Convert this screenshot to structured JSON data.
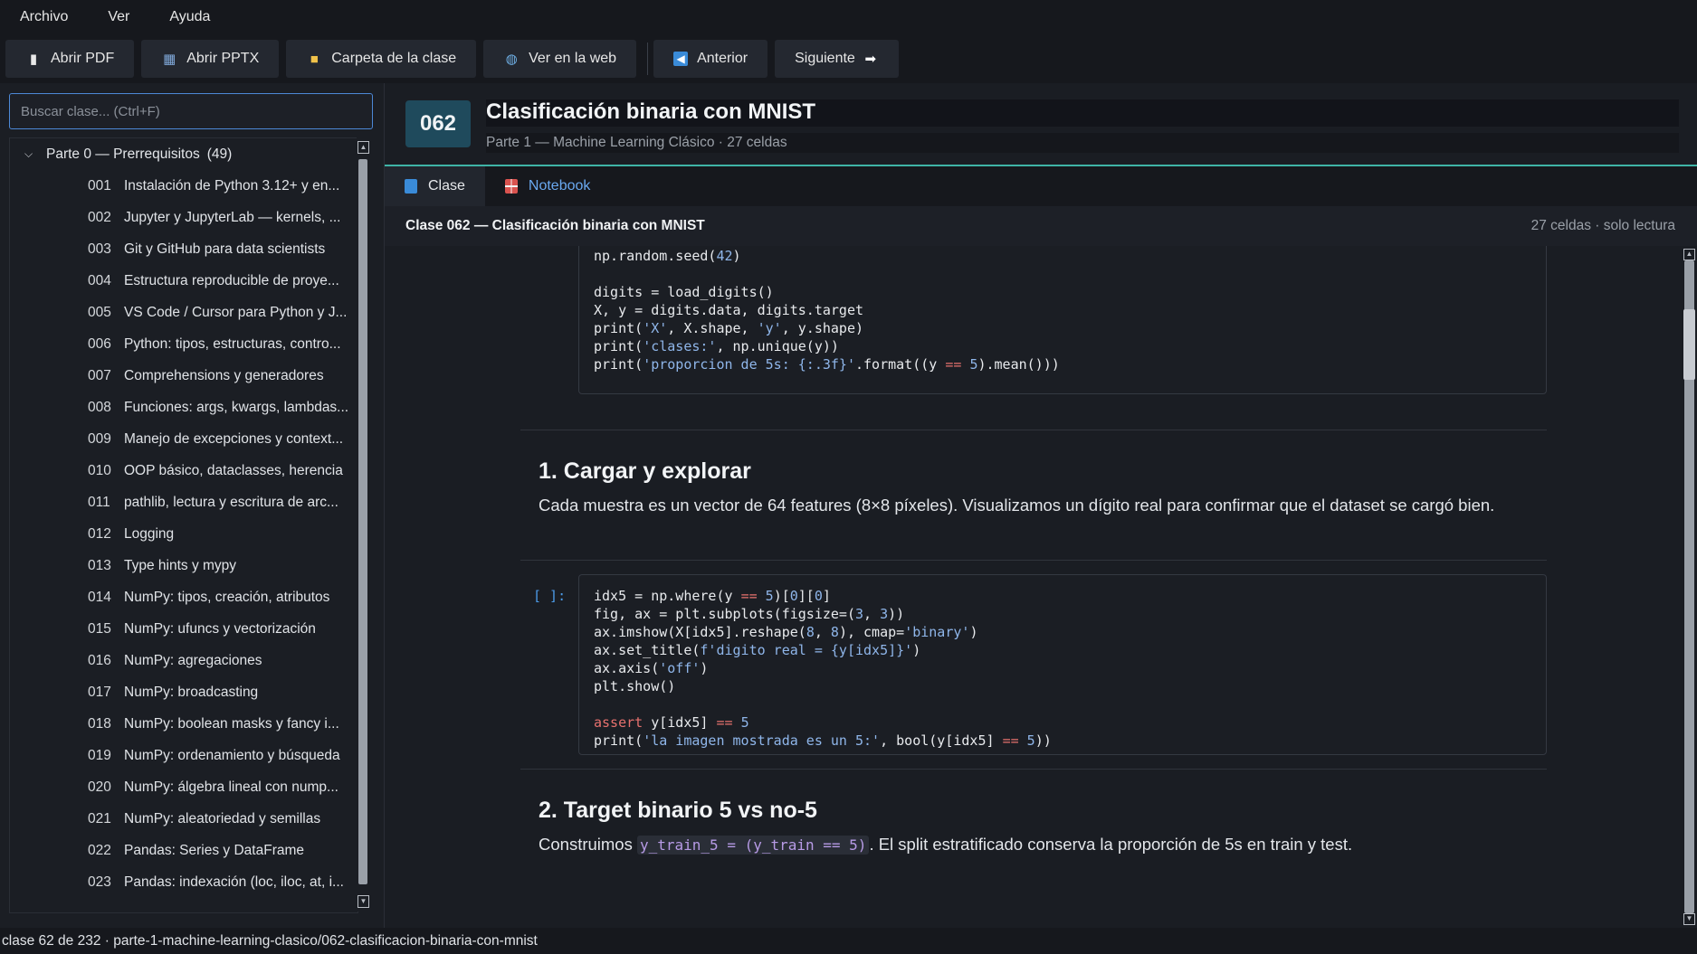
{
  "menu": [
    "Archivo",
    "Ver",
    "Ayuda"
  ],
  "toolbar": {
    "open_pdf": "Abrir PDF",
    "open_pptx": "Abrir PPTX",
    "class_folder": "Carpeta de la clase",
    "view_web": "Ver en la web",
    "previous": "Anterior",
    "next": "Siguiente"
  },
  "sidebar": {
    "search_placeholder": "Buscar clase... (Ctrl+F)",
    "group": {
      "label": "Parte 0 — Prerrequisitos",
      "count": "(49)"
    },
    "items": [
      {
        "num": "001",
        "title": "Instalación de Python 3.12+ y en..."
      },
      {
        "num": "002",
        "title": "Jupyter y JupyterLab — kernels, ..."
      },
      {
        "num": "003",
        "title": "Git y GitHub para data scientists"
      },
      {
        "num": "004",
        "title": "Estructura reproducible de proye..."
      },
      {
        "num": "005",
        "title": "VS Code / Cursor para Python y J..."
      },
      {
        "num": "006",
        "title": "Python: tipos, estructuras, contro..."
      },
      {
        "num": "007",
        "title": "Comprehensions y generadores"
      },
      {
        "num": "008",
        "title": "Funciones: args, kwargs, lambdas..."
      },
      {
        "num": "009",
        "title": "Manejo de excepciones y context..."
      },
      {
        "num": "010",
        "title": "OOP básico, dataclasses, herencia"
      },
      {
        "num": "011",
        "title": "pathlib, lectura y escritura de arc..."
      },
      {
        "num": "012",
        "title": "Logging"
      },
      {
        "num": "013",
        "title": "Type hints y mypy"
      },
      {
        "num": "014",
        "title": "NumPy: tipos, creación, atributos"
      },
      {
        "num": "015",
        "title": "NumPy: ufuncs y vectorización"
      },
      {
        "num": "016",
        "title": "NumPy: agregaciones"
      },
      {
        "num": "017",
        "title": "NumPy: broadcasting"
      },
      {
        "num": "018",
        "title": "NumPy: boolean masks y fancy i..."
      },
      {
        "num": "019",
        "title": "NumPy: ordenamiento y búsqueda"
      },
      {
        "num": "020",
        "title": "NumPy: álgebra lineal con nump..."
      },
      {
        "num": "021",
        "title": "NumPy: aleatoriedad y semillas"
      },
      {
        "num": "022",
        "title": "Pandas: Series y DataFrame"
      },
      {
        "num": "023",
        "title": "Pandas: indexación (loc, iloc, at, i..."
      }
    ]
  },
  "lesson": {
    "number": "062",
    "title": "Clasificación binaria con MNIST",
    "part": "Parte 1 — Machine Learning Clásico",
    "cells": "27 celdas"
  },
  "tabs": {
    "clase": "Clase",
    "notebook": "Notebook"
  },
  "notebook": {
    "header_title": "Clase 062 — Clasificación binaria con MNIST",
    "header_meta": "27 celdas · solo lectura",
    "prompt": "[ ]:",
    "section1_title": "1. Cargar y explorar",
    "section1_text": "Cada muestra es un vector de 64 features (8×8 píxeles). Visualizamos un dígito real para confirmar que el dataset se cargó bien.",
    "section2_title": "2. Target binario 5 vs no-5",
    "section2_text_before": "Construimos ",
    "section2_code": "y_train_5 = (y_train == 5)",
    "section2_text_after": ". El split estratificado conserva la proporción de 5s en train y test."
  },
  "status": "clase 62 de 232  ·  parte-1-machine-learning-clasico/062-clasificacion-binaria-con-mnist"
}
